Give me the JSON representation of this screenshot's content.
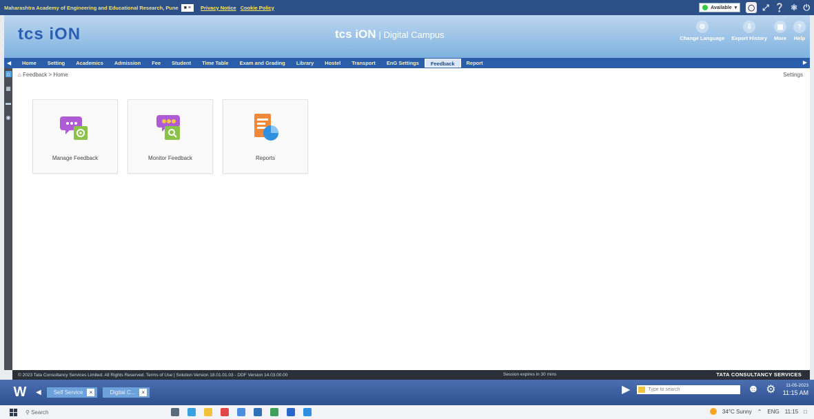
{
  "topbar": {
    "institute": "Maharashtra Academy of Engineering and Educational Research, Pune",
    "privacy_link": "Privacy Notice",
    "cookie_link": "Cookie Policy",
    "status": "Available"
  },
  "header": {
    "logo": "tcs iON",
    "brand": "tcs iON",
    "brand_suffix": "| Digital Campus",
    "change_language": "Change Language",
    "export_history": "Export History",
    "more": "More",
    "help": "Help"
  },
  "nav": {
    "items": [
      {
        "label": "Home"
      },
      {
        "label": "Setting"
      },
      {
        "label": "Academics"
      },
      {
        "label": "Admission"
      },
      {
        "label": "Fee"
      },
      {
        "label": "Student"
      },
      {
        "label": "Time Table"
      },
      {
        "label": "Exam and Grading"
      },
      {
        "label": "Library"
      },
      {
        "label": "Hostel"
      },
      {
        "label": "Transport"
      },
      {
        "label": "EnG Settings"
      },
      {
        "label": "Feedback"
      },
      {
        "label": "Report"
      }
    ],
    "active": "Feedback"
  },
  "main": {
    "breadcrumb": "Feedback > Home",
    "settings": "Settings",
    "tiles": [
      {
        "label": "Manage Feedback",
        "icon": "manage-feedback-icon"
      },
      {
        "label": "Monitor Feedback",
        "icon": "monitor-feedback-icon"
      },
      {
        "label": "Reports",
        "icon": "reports-icon"
      }
    ]
  },
  "footer": {
    "copyright": "© 2023 Tata Consultancy Services Limited. All Rights Reserved.  Terms of Use | Solution Version 18.01.01.03 - DDF Version 14.03.00.00",
    "session": "Session expires in 30 mins",
    "company": "TATA CONSULTANCY SERVICES"
  },
  "apptaskbar": {
    "tabs": [
      {
        "label": "Self Service"
      },
      {
        "label": "Digital C..."
      }
    ],
    "search_placeholder": "Type to search",
    "time": "11:15 AM",
    "date": "11-05-2023"
  },
  "wintaskbar": {
    "search": "Search",
    "weather": "34°C Sunny",
    "lang": "ENG",
    "time": "11:15"
  },
  "colors": {
    "nav_bg": "#2a5ea9",
    "header_bg": "#7fb1df",
    "accent_purple": "#b05bd6",
    "accent_green": "#8bc34a",
    "accent_orange": "#f08a3a",
    "accent_blue": "#2f8fe0"
  }
}
